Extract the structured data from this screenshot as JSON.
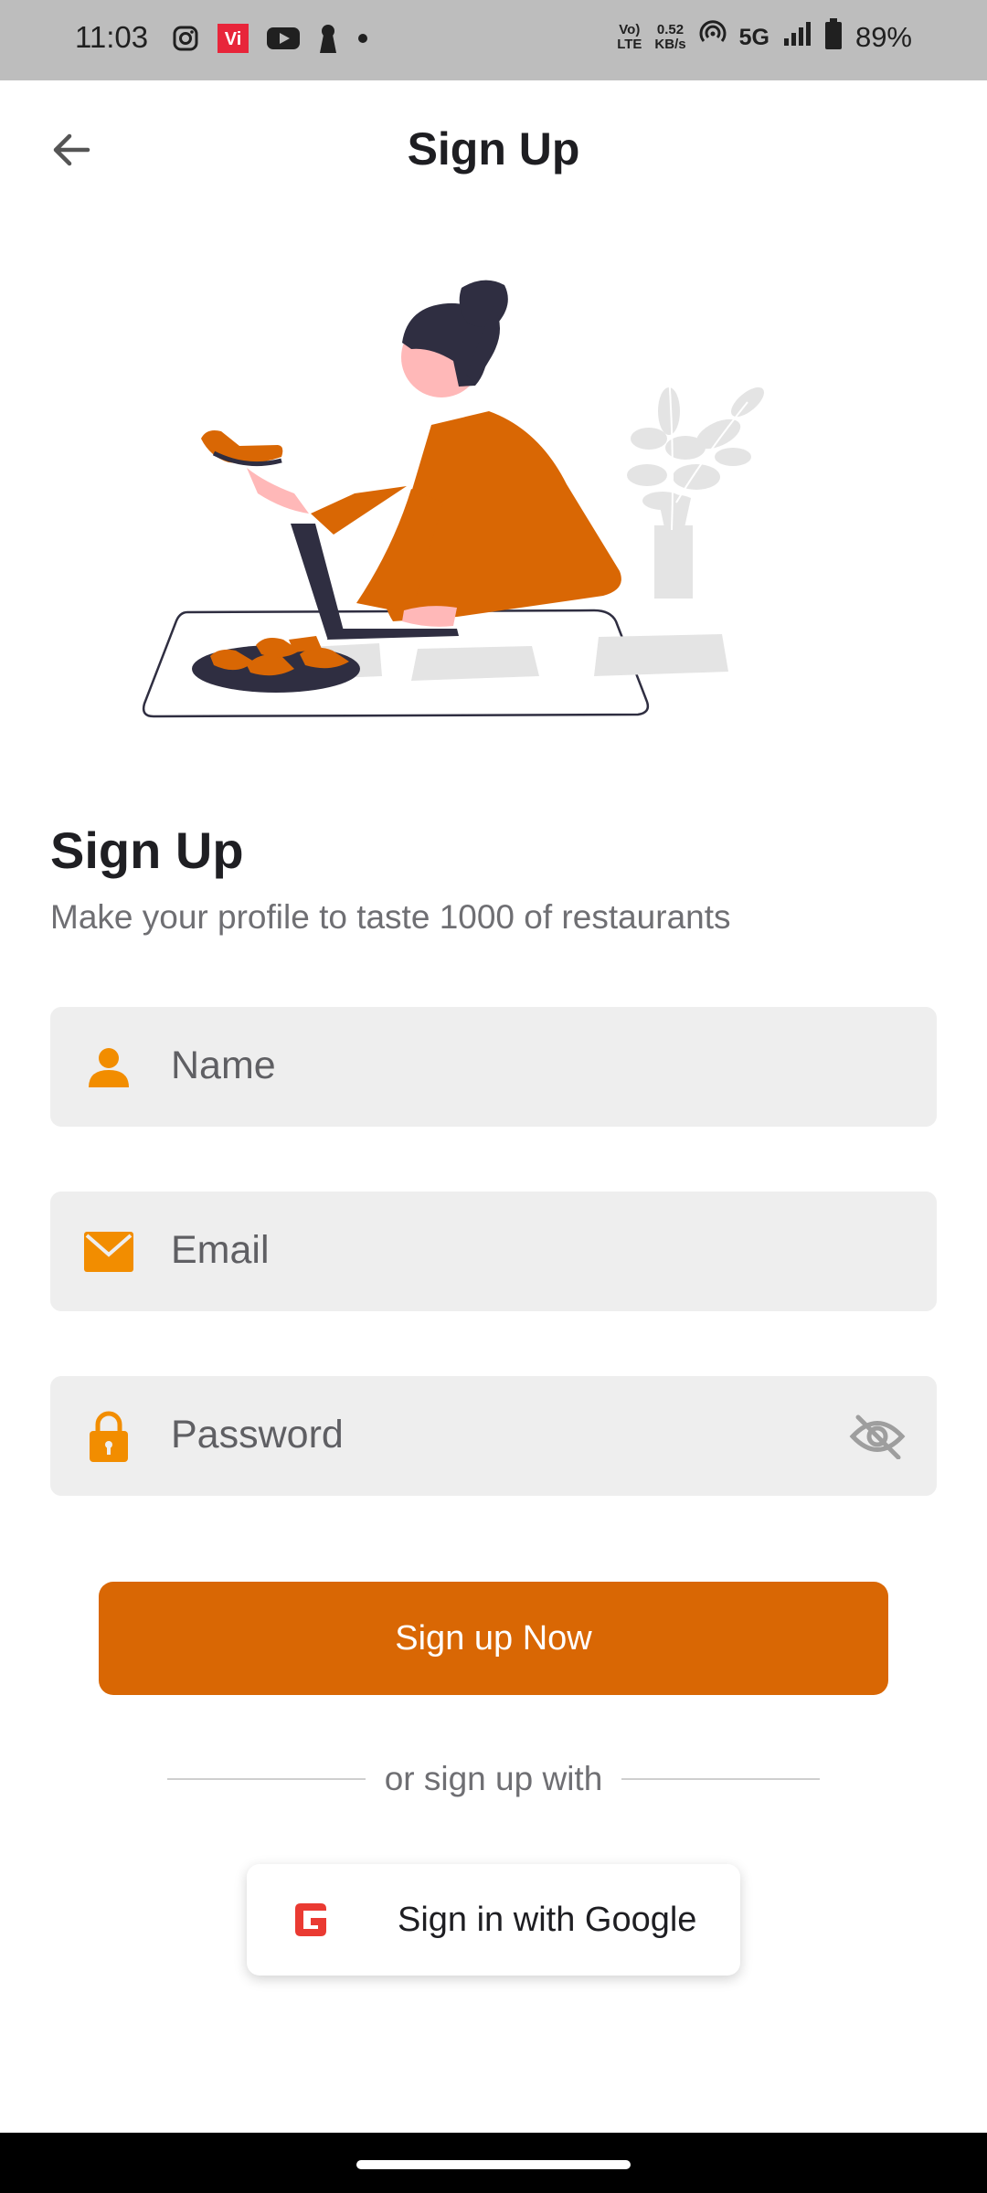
{
  "status_bar": {
    "time": "11:03",
    "data_speed_value": "0.52",
    "data_speed_unit": "KB/s",
    "volte_top": "Vo)",
    "volte_bottom": "LTE",
    "network": "5G",
    "battery": "89%",
    "icons": [
      "instagram-icon",
      "vi-icon",
      "youtube-icon",
      "keyhole-icon",
      "dot-icon",
      "volte-icon",
      "hotspot-icon",
      "signal-icon",
      "battery-icon"
    ]
  },
  "app_bar": {
    "title": "Sign Up",
    "back_icon": "arrow-left-icon"
  },
  "illustration": {
    "name": "woman-ordering-food-illustration"
  },
  "header": {
    "title": "Sign Up",
    "subtitle": "Make your profile to taste 1000 of restaurants"
  },
  "form": {
    "name": {
      "placeholder": "Name",
      "icon": "person-icon"
    },
    "email": {
      "placeholder": "Email",
      "icon": "mail-icon"
    },
    "password": {
      "placeholder": "Password",
      "icon": "lock-icon",
      "toggle_icon": "eye-off-icon"
    }
  },
  "actions": {
    "submit_label": "Sign up Now",
    "divider_text": "or sign up with",
    "google_label": "Sign in with Google"
  },
  "colors": {
    "accent": "#D96704",
    "field_background": "#EEEEEE",
    "status_bar": "#BDBDBD"
  }
}
